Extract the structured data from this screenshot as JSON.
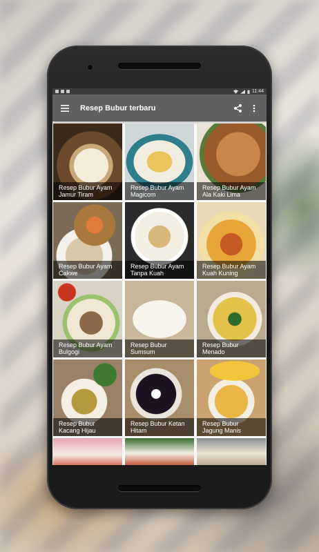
{
  "status_bar": {
    "time": "11:44"
  },
  "app_bar": {
    "title": "Resep Bubur terbaru",
    "menu_icon": "hamburger-menu-icon",
    "share_icon": "share-icon",
    "overflow_icon": "more-vert-icon"
  },
  "colors": {
    "app_bar": "#616161",
    "status_bar": "#3d3d3d",
    "caption_overlay": "rgba(0,0,0,0.55)"
  },
  "recipes": [
    {
      "line1": "Resep Bubur Ayam",
      "line2": "Jamur Tiram"
    },
    {
      "line1": "Resep Bubur Ayam",
      "line2": "Magicom"
    },
    {
      "line1": "Resep Bubur Ayam",
      "line2": "Ala Kaki Lima"
    },
    {
      "line1": "Resep Bubur Ayam",
      "line2": "Cakwe"
    },
    {
      "line1": "Resep Bubur Ayam",
      "line2": "Tanpa Kuah"
    },
    {
      "line1": "Resep Bubur Ayam",
      "line2": "Kuah Kuning"
    },
    {
      "line1": "Resep Bubur Ayam",
      "line2": "Bulgogi"
    },
    {
      "line1": "Resep Bubur",
      "line2": "Sumsum"
    },
    {
      "line1": "Resep Bubur",
      "line2": "Menado"
    },
    {
      "line1": "Resep Bubur",
      "line2": "Kacang Hijau"
    },
    {
      "line1": "Resep Bubur Ketan",
      "line2": "Hitam"
    },
    {
      "line1": "Resep Bubur",
      "line2": "Jagung Manis"
    }
  ]
}
